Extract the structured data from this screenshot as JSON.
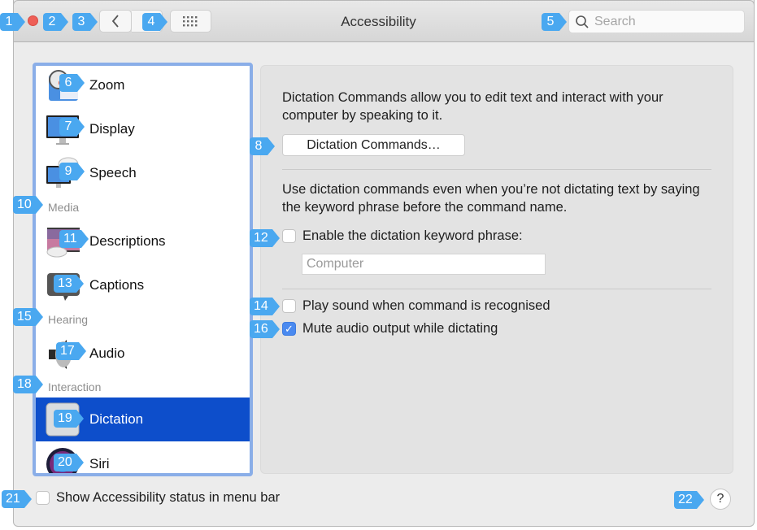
{
  "window": {
    "title": "Accessibility",
    "search_placeholder": "Search"
  },
  "toolbar": {
    "close_icon": "close-button-red",
    "back_icon": "chevron-left-icon",
    "grid_icon": "grid-icon"
  },
  "sidebar": {
    "items": [
      {
        "label": "Zoom",
        "icon": "zoom-icon"
      },
      {
        "label": "Display",
        "icon": "display-icon"
      },
      {
        "label": "Speech",
        "icon": "speech-icon"
      },
      {
        "section": "Media"
      },
      {
        "label": "Descriptions",
        "icon": "descriptions-icon"
      },
      {
        "label": "Captions",
        "icon": "captions-icon"
      },
      {
        "section": "Hearing"
      },
      {
        "label": "Audio",
        "icon": "audio-icon"
      },
      {
        "section": "Interaction"
      },
      {
        "label": "Dictation",
        "icon": "dictation-icon",
        "selected": true
      },
      {
        "label": "Siri",
        "icon": "siri-icon"
      }
    ]
  },
  "panel": {
    "intro": "Dictation Commands allow you to edit text and interact with your computer by speaking to it.",
    "commands_button": "Dictation Commands…",
    "keyword_desc": "Use dictation commands even when you’re not dictating text by saying the keyword phrase before the command name.",
    "enable_keyword": {
      "label": "Enable the dictation keyword phrase:",
      "checked": false
    },
    "keyword_input_placeholder": "Computer",
    "play_sound": {
      "label": "Play sound when command is recognised",
      "checked": false
    },
    "mute_audio": {
      "label": "Mute audio output while dictating",
      "checked": true
    }
  },
  "footer": {
    "show_status": {
      "label": "Show Accessibility status in menu bar",
      "checked": false
    },
    "help_label": "?"
  },
  "badges": [
    "1",
    "2",
    "3",
    "4",
    "5",
    "6",
    "7",
    "8",
    "9",
    "10",
    "11",
    "12",
    "13",
    "14",
    "15",
    "16",
    "17",
    "18",
    "19",
    "20",
    "21",
    "22"
  ],
  "colors": {
    "selection": "#0d4ecb",
    "sidebar_focus_ring": "#8aaee8",
    "checkbox_checked": "#4a8af0",
    "badge": "#4aa8f0",
    "close_button": "#ee5f57"
  }
}
